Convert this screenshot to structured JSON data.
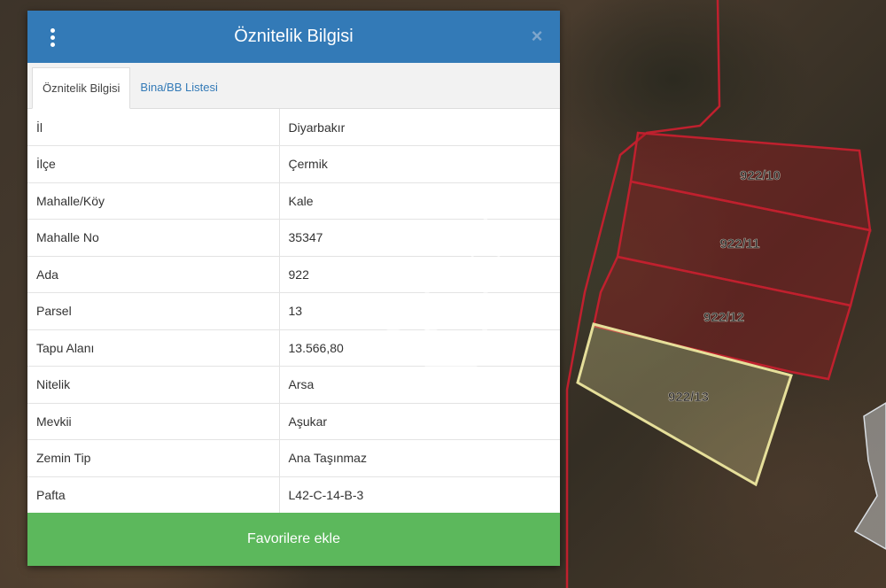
{
  "dialog": {
    "title": "Öznitelik Bilgisi",
    "close_symbol": "×",
    "tabs": [
      {
        "label": "Öznitelik Bilgisi",
        "active": true
      },
      {
        "label": "Bina/BB Listesi",
        "active": false
      }
    ],
    "attributes": [
      {
        "key": "İl",
        "value": "Diyarbakır"
      },
      {
        "key": "İlçe",
        "value": "Çermik"
      },
      {
        "key": "Mahalle/Köy",
        "value": "Kale"
      },
      {
        "key": "Mahalle No",
        "value": "35347"
      },
      {
        "key": "Ada",
        "value": "922"
      },
      {
        "key": "Parsel",
        "value": "13"
      },
      {
        "key": "Tapu Alanı",
        "value": "13.566,80"
      },
      {
        "key": "Nitelik",
        "value": "Arsa"
      },
      {
        "key": "Mevkii",
        "value": "Aşukar"
      },
      {
        "key": "Zemin Tip",
        "value": "Ana Taşınmaz"
      },
      {
        "key": "Pafta",
        "value": "L42-C-14-B-3"
      }
    ],
    "favorite_button_label": "Favorilere ekle"
  },
  "map": {
    "parcels": [
      {
        "label": "922/10",
        "color": "#c0202e"
      },
      {
        "label": "922/11",
        "color": "#c0202e"
      },
      {
        "label": "922/12",
        "color": "#c0202e"
      },
      {
        "label": "922/13",
        "color": "#e6df9a"
      }
    ]
  },
  "watermark": {
    "text": "CB",
    "mark": "SM"
  },
  "colors": {
    "header": "#337ab7",
    "favorite_button": "#5cb85c",
    "parcel_outline": "#c0202e",
    "selected_parcel": "#e6df9a"
  },
  "icons": [
    "menu-dots-icon",
    "close-icon",
    "star-icon"
  ]
}
